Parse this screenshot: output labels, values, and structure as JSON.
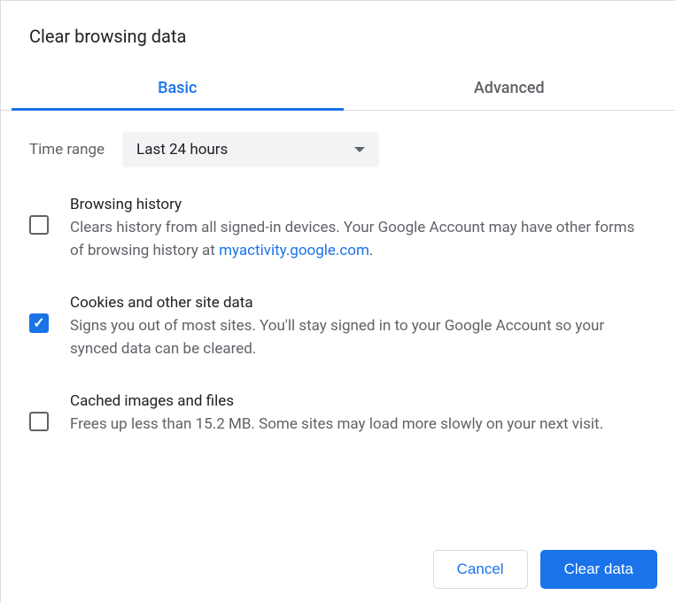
{
  "title": "Clear browsing data",
  "tabs": {
    "basic": "Basic",
    "advanced": "Advanced"
  },
  "time_range": {
    "label": "Time range",
    "selected": "Last 24 hours"
  },
  "options": {
    "browsing_history": {
      "checked": false,
      "title": "Browsing history",
      "desc_before": "Clears history from all signed-in devices. Your Google Account may have other forms of browsing history at ",
      "link": "myactivity.google.com",
      "desc_after": "."
    },
    "cookies": {
      "checked": true,
      "title": "Cookies and other site data",
      "desc": "Signs you out of most sites. You'll stay signed in to your Google Account so your synced data can be cleared."
    },
    "cache": {
      "checked": false,
      "title": "Cached images and files",
      "desc": "Frees up less than 15.2 MB. Some sites may load more slowly on your next visit."
    }
  },
  "buttons": {
    "cancel": "Cancel",
    "clear": "Clear data"
  }
}
